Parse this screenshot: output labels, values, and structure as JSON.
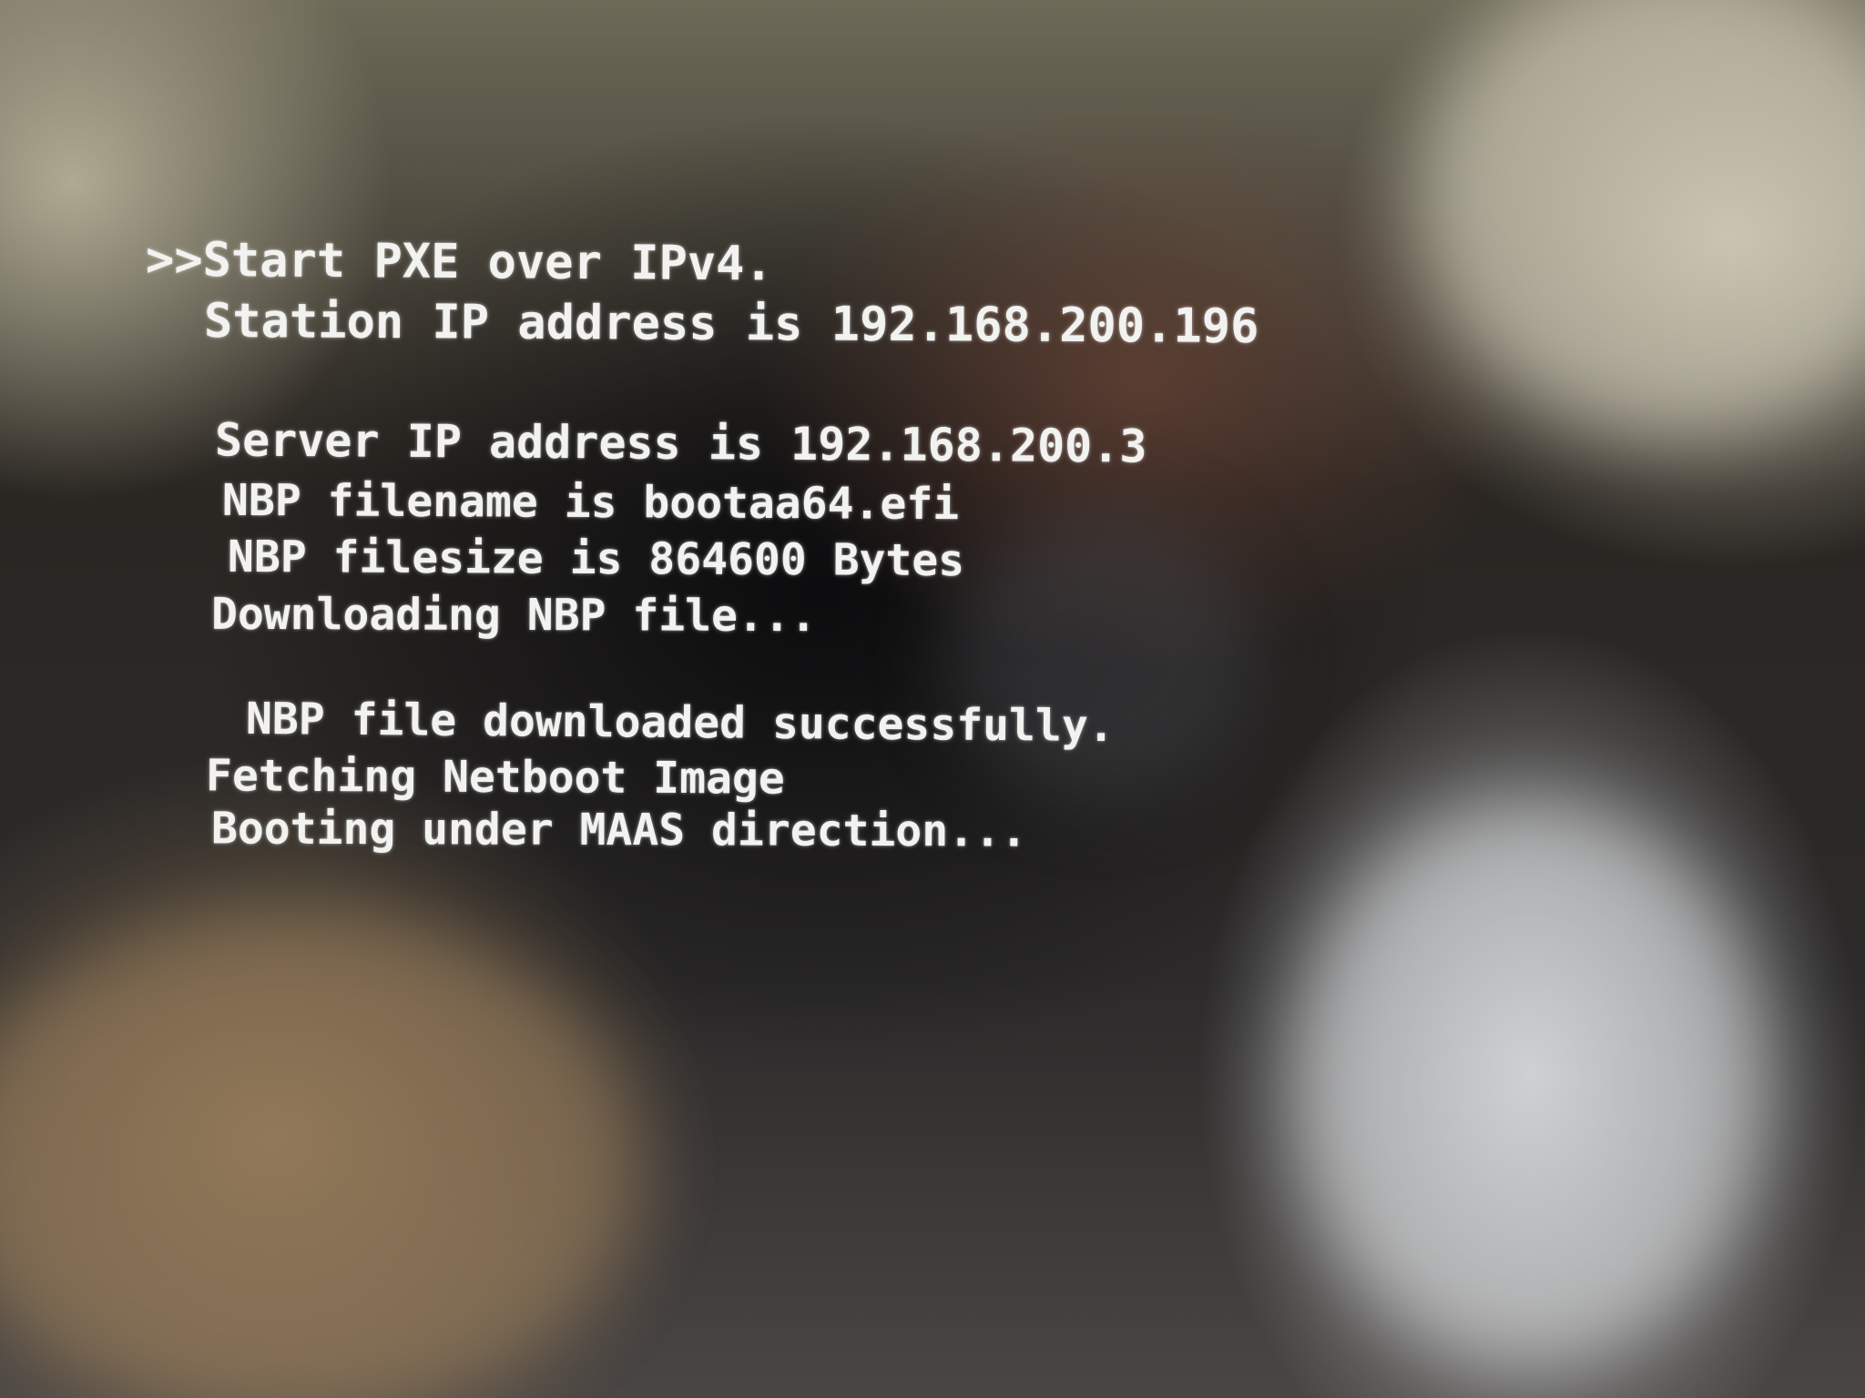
{
  "console": {
    "lines": [
      ">>Start PXE over IPv4.",
      "Station IP address is 192.168.200.196",
      "Server IP address is 192.168.200.3",
      "NBP filename is bootaa64.efi",
      "NBP filesize is 864600 Bytes",
      "Downloading NBP file...",
      "NBP file downloaded successfully.",
      "Fetching Netboot Image",
      "Booting under MAAS direction..."
    ]
  },
  "colors": {
    "text": "#f2f2f0",
    "screen_background": "#0c0c0e"
  }
}
